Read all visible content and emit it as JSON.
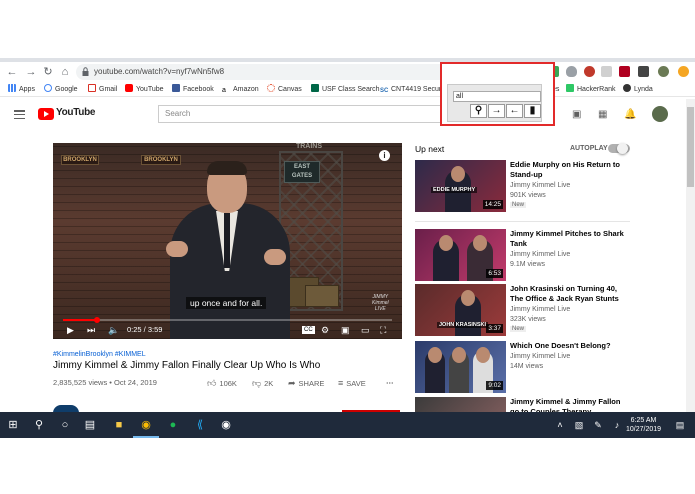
{
  "browser": {
    "url": "youtube.com/watch?v=nyf7wNn5fw8",
    "bookmarks": [
      "Apps",
      "Google",
      "Gmail",
      "YouTube",
      "Facebook",
      "Amazon",
      "Canvas",
      "USF Class Search",
      "CNT4419 Secure Co",
      "ntivities",
      "HackerRank",
      "Lynda"
    ]
  },
  "youtube": {
    "search_placeholder": "Search",
    "logo_text": "YouTube"
  },
  "video": {
    "caption": "up once and for all.",
    "time": "0:25 / 3:59",
    "progress": 0.104,
    "hashtags": "#KimmelinBrooklyn #KIMMEL",
    "title": "Jimmy Kimmel & Jimmy Fallon Finally Clear Up Who Is Who",
    "views_date": "2,835,525 views • Oct 24, 2019",
    "likes": "106K",
    "dislikes": "2K",
    "share": "SHARE",
    "save": "SAVE",
    "scene": {
      "brooklyn_left": "BROOKLYN",
      "brooklyn_right": "BROOKLYN",
      "trains": "TRAINS",
      "east_gates": "EAST GATES"
    }
  },
  "upnext": {
    "heading": "Up next",
    "autoplay": "AUTOPLAY",
    "items": [
      {
        "title": "Eddie Murphy on His Return to Stand-up",
        "channel": "Jimmy Kimmel Live",
        "views": "901K views",
        "badge": "New",
        "duration": "14:25",
        "thumb_label": "EDDIE MURPHY"
      },
      {
        "title": "Jimmy Kimmel Pitches to Shark Tank",
        "channel": "Jimmy Kimmel Live",
        "views": "9.1M views",
        "badge": "",
        "duration": "6:53",
        "thumb_label": ""
      },
      {
        "title": "John Krasinski on Turning 40, The Office & Jack Ryan Stunts",
        "channel": "Jimmy Kimmel Live",
        "views": "323K views",
        "badge": "New",
        "duration": "3:37",
        "thumb_label": "JOHN KRASINSKI"
      },
      {
        "title": "Which One Doesn't Belong?",
        "channel": "Jimmy Kimmel Live",
        "views": "14M views",
        "badge": "",
        "duration": "9:02",
        "thumb_label": ""
      },
      {
        "title": "Jimmy Kimmel & Jimmy Fallon go to Couples Therapy",
        "channel": "",
        "views": "",
        "badge": "",
        "duration": "",
        "thumb_label": ""
      }
    ]
  },
  "extension_popup": {
    "input_value": "all"
  },
  "taskbar": {
    "time": "6:25 AM",
    "date": "10/27/2019"
  },
  "colors": {
    "accent": "#ff0000",
    "popup_border": "#e22a2a",
    "taskbar": "#1f2a3b",
    "link": "#065fd4"
  }
}
